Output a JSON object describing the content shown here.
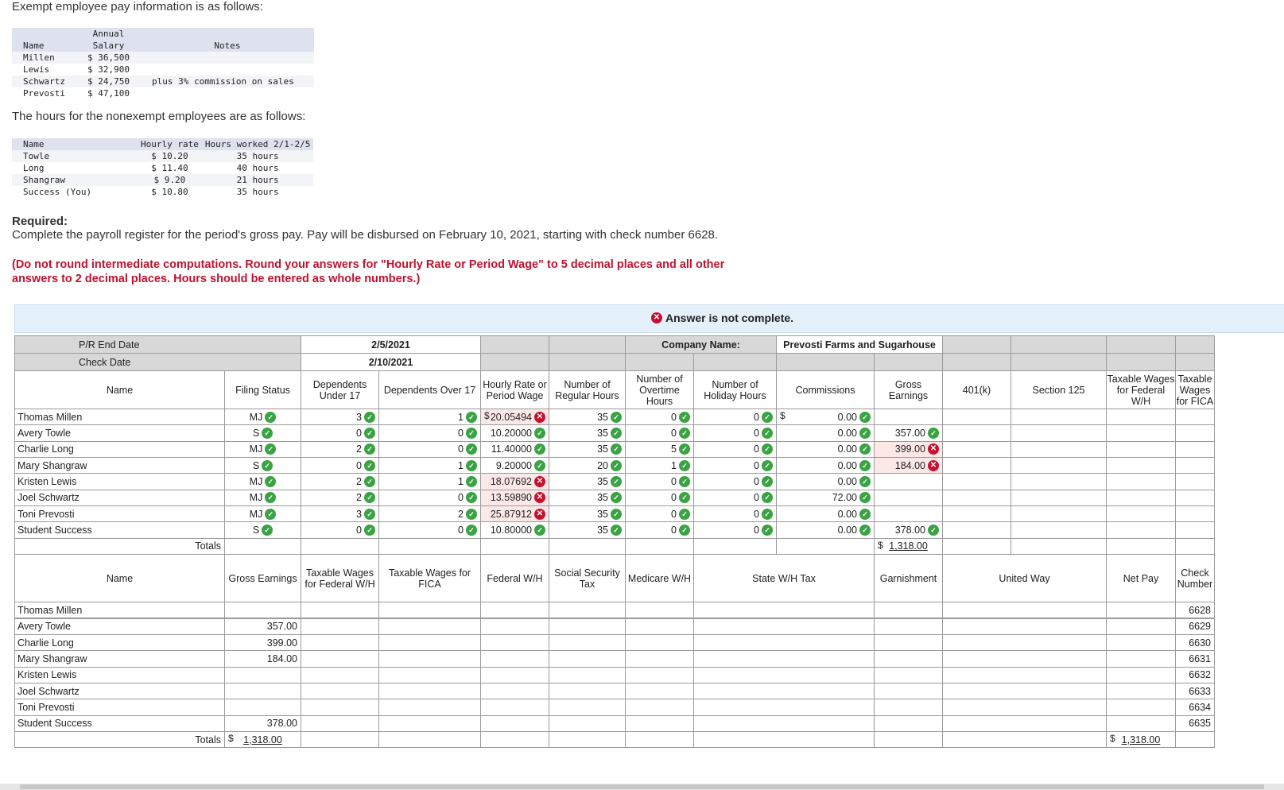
{
  "intro1": "Exempt employee pay information is as follows:",
  "exempt_table": {
    "headers": [
      "Name",
      "Annual\nSalary",
      "Notes"
    ],
    "rows": [
      [
        "Millen",
        "$ 36,500",
        ""
      ],
      [
        "Lewis",
        "$ 32,900",
        ""
      ],
      [
        "Schwartz",
        "$ 24,750",
        "plus 3% commission on sales"
      ],
      [
        "Prevosti",
        "$ 47,100",
        ""
      ]
    ]
  },
  "intro2": "The hours for the nonexempt employees are as follows:",
  "hours_table": {
    "headers": [
      "Name",
      "Hourly rate",
      "Hours worked 2/1-2/5"
    ],
    "rows": [
      [
        "Towle",
        "$ 10.20",
        "35 hours"
      ],
      [
        "Long",
        "$ 11.40",
        "40 hours"
      ],
      [
        "Shangraw",
        "$ 9.20",
        "21 hours"
      ],
      [
        "Success (You)",
        "$ 10.80",
        "35 hours"
      ]
    ]
  },
  "required_label": "Required:",
  "required_text": "Complete the payroll register for the period's gross pay. Pay will be disbursed on February 10, 2021, starting with check number 6628.",
  "instructions": "(Do not round intermediate computations. Round your answers for \"Hourly Rate or Period Wage\" to 5 decimal places and all other answers to 2 decimal places. Hours should be entered as whole numbers.)",
  "banner_text": "Answer is not complete.",
  "register": {
    "pr_end_label": "P/R End Date",
    "pr_end_value": "2/5/2021",
    "check_date_label": "Check Date",
    "check_date_value": "2/10/2021",
    "company_label": "Company Name:",
    "company_value": "Prevosti Farms and Sugarhouse",
    "currency": "$",
    "headers1": [
      "Name",
      "Filing Status",
      "Dependents Under 17",
      "Dependents Over 17",
      "Hourly Rate or Period Wage",
      "Number of Regular Hours",
      "Number of Overtime Hours",
      "Number of Holiday Hours",
      "Commissions",
      "Gross Earnings",
      "401(k)",
      "Section 125",
      "Taxable Wages for Federal W/H",
      "Taxable Wages for FICA"
    ],
    "rows1": [
      {
        "name": "Thomas Millen",
        "filing": "MJ",
        "dep17": "3",
        "depover": "1",
        "rate": "20.05494",
        "rate_ok": false,
        "reg": "35",
        "ot": "0",
        "hol": "0",
        "comm": "0.00",
        "gross": "",
        "gross_ok": null
      },
      {
        "name": "Avery Towle",
        "filing": "S",
        "dep17": "0",
        "depover": "0",
        "rate": "10.20000",
        "rate_ok": true,
        "reg": "35",
        "ot": "0",
        "hol": "0",
        "comm": "0.00",
        "gross": "357.00",
        "gross_ok": true
      },
      {
        "name": "Charlie Long",
        "filing": "MJ",
        "dep17": "2",
        "depover": "0",
        "rate": "11.40000",
        "rate_ok": true,
        "reg": "35",
        "ot": "5",
        "hol": "0",
        "comm": "0.00",
        "gross": "399.00",
        "gross_ok": false
      },
      {
        "name": "Mary Shangraw",
        "filing": "S",
        "dep17": "0",
        "depover": "1",
        "rate": "9.20000",
        "rate_ok": true,
        "reg": "20",
        "ot": "1",
        "hol": "0",
        "comm": "0.00",
        "gross": "184.00",
        "gross_ok": false
      },
      {
        "name": "Kristen Lewis",
        "filing": "MJ",
        "dep17": "2",
        "depover": "1",
        "rate": "18.07692",
        "rate_ok": false,
        "reg": "35",
        "ot": "0",
        "hol": "0",
        "comm": "0.00",
        "gross": "",
        "gross_ok": null
      },
      {
        "name": "Joel Schwartz",
        "filing": "MJ",
        "dep17": "2",
        "depover": "0",
        "rate": "13.59890",
        "rate_ok": false,
        "reg": "35",
        "ot": "0",
        "hol": "0",
        "comm": "72.00",
        "gross": "",
        "gross_ok": null
      },
      {
        "name": "Toni Prevosti",
        "filing": "MJ",
        "dep17": "3",
        "depover": "2",
        "rate": "25.87912",
        "rate_ok": false,
        "reg": "35",
        "ot": "0",
        "hol": "0",
        "comm": "0.00",
        "gross": "",
        "gross_ok": null
      },
      {
        "name": "Student Success",
        "filing": "S",
        "dep17": "0",
        "depover": "0",
        "rate": "10.80000",
        "rate_ok": true,
        "reg": "35",
        "ot": "0",
        "hol": "0",
        "comm": "0.00",
        "gross": "378.00",
        "gross_ok": true
      }
    ],
    "totals_label": "Totals",
    "gross_total": "1,318.00",
    "headers2": [
      "Name",
      "Gross Earnings",
      "Taxable Wages for Federal W/H",
      "Taxable Wages for FICA",
      "Federal W/H",
      "Social Security Tax",
      "Medicare W/H",
      "State W/H Tax",
      "Garnishment",
      "United Way",
      "Net Pay",
      "Check Number"
    ],
    "rows2": [
      {
        "name": "Thomas Millen",
        "gross": "",
        "check": "6628"
      },
      {
        "name": "Avery Towle",
        "gross": "357.00",
        "check": "6629"
      },
      {
        "name": "Charlie Long",
        "gross": "399.00",
        "check": "6630"
      },
      {
        "name": "Mary Shangraw",
        "gross": "184.00",
        "check": "6631"
      },
      {
        "name": "Kristen Lewis",
        "gross": "",
        "check": "6632"
      },
      {
        "name": "Joel Schwartz",
        "gross": "",
        "check": "6633"
      },
      {
        "name": "Toni Prevosti",
        "gross": "",
        "check": "6634"
      },
      {
        "name": "Student Success",
        "gross": "378.00",
        "check": "6635"
      }
    ],
    "net_pay_total": "1,318.00"
  }
}
